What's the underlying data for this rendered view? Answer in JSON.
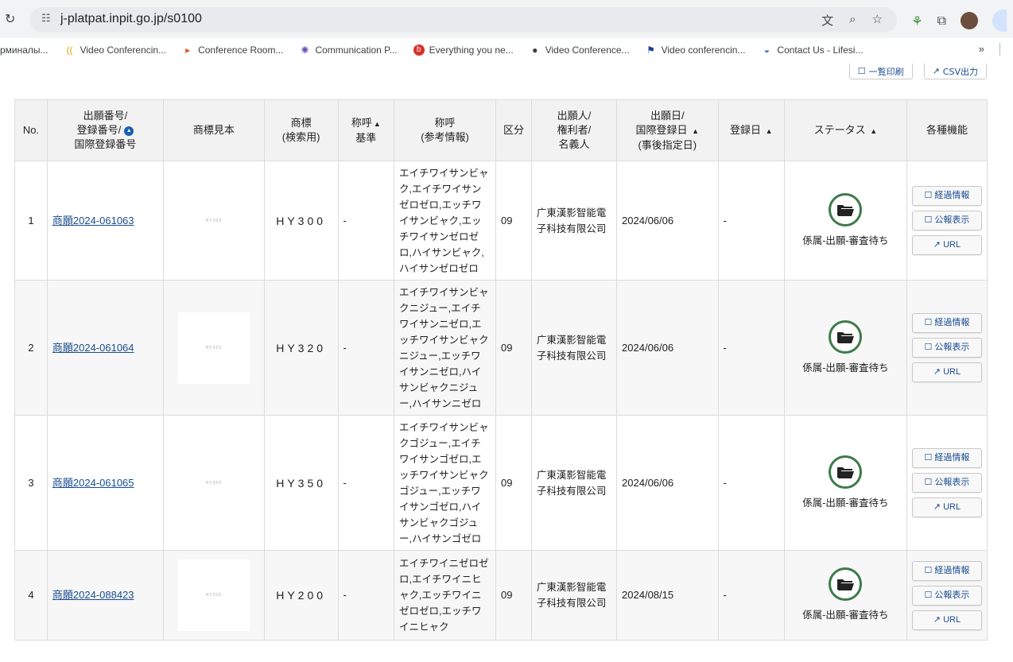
{
  "browser": {
    "url": "j-platpat.inpit.go.jp/s0100"
  },
  "bookmarks": [
    {
      "label": "рминалы...",
      "icon": ""
    },
    {
      "label": "Video Conferencin...",
      "icon": "signal-icon"
    },
    {
      "label": "Conference Room...",
      "icon": "play-icon"
    },
    {
      "label": "Communication P...",
      "icon": "star-icon"
    },
    {
      "label": "Everything you ne...",
      "icon": "b-icon"
    },
    {
      "label": "Video Conference...",
      "icon": "globe-icon"
    },
    {
      "label": "Video conferencin...",
      "icon": "flag-icon"
    },
    {
      "label": "Contact Us - Lifesi...",
      "icon": "lifesize-icon"
    }
  ],
  "bookmarks_more": "»",
  "actions": {
    "print_label": "一覧印刷",
    "csv_label": "CSV出力"
  },
  "table": {
    "headers": {
      "no": "No.",
      "app_no_1": "出願番号/",
      "app_no_2": "登録番号/",
      "app_no_3": "国際登録番号",
      "sample": "商標見本",
      "mark_1": "商標",
      "mark_2": "(検索用)",
      "base_1": "称呼",
      "base_2": "基準",
      "ref_1": "称呼",
      "ref_2": "(参考情報)",
      "class": "区分",
      "owner_1": "出願人/",
      "owner_2": "権利者/",
      "owner_3": "名義人",
      "date_1": "出願日/",
      "date_2": "国際登録日",
      "date_3": "(事後指定日)",
      "reg_date": "登録日",
      "status": "ステータス",
      "functions": "各種機能"
    },
    "rows": [
      {
        "no": "1",
        "app_no": "商願2024-061063",
        "sample_text": "HY300",
        "mark": "HY300",
        "base": "-",
        "reference": "エイチワイサンビャク,エイチワイサンゼロゼロ,エッチワイサンビャク,エッチワイサンゼロゼロ,ハイサンビャク,ハイサンゼロゼロ",
        "class": "09",
        "owner": "广東漢影智能電子科技有限公司",
        "date": "2024/06/06",
        "reg_date": "-",
        "status": "係属-出願-審査待ち"
      },
      {
        "no": "2",
        "app_no": "商願2024-061064",
        "sample_text": "HY320",
        "mark": "HY320",
        "base": "-",
        "reference": "エイチワイサンビャクニジュー,エイチワイサンニゼロ,エッチワイサンビャクニジュー,エッチワイサンニゼロ,ハイサンビャクニジュー,ハイサンニゼロ",
        "class": "09",
        "owner": "广東漢影智能電子科技有限公司",
        "date": "2024/06/06",
        "reg_date": "-",
        "status": "係属-出願-審査待ち"
      },
      {
        "no": "3",
        "app_no": "商願2024-061065",
        "sample_text": "HY350",
        "mark": "HY350",
        "base": "-",
        "reference": "エイチワイサンビャクゴジュー,エイチワイサンゴゼロ,エッチワイサンビャクゴジュー,エッチワイサンゴゼロ,ハイサンビャクゴジュー,ハイサンゴゼロ",
        "class": "09",
        "owner": "广東漢影智能電子科技有限公司",
        "date": "2024/06/06",
        "reg_date": "-",
        "status": "係属-出願-審査待ち"
      },
      {
        "no": "4",
        "app_no": "商願2024-088423",
        "sample_text": "HY200",
        "mark": "HY200",
        "base": "-",
        "reference": "エイチワイニゼロゼロ,エイチワイニヒャク,エッチワイニゼロゼロ,エッチワイニヒャク",
        "class": "09",
        "owner": "广東漢影智能電子科技有限公司",
        "date": "2024/08/15",
        "reg_date": "-",
        "status": "係属-出願-審査待ち"
      }
    ],
    "function_buttons": {
      "progress": "経過情報",
      "gazette": "公報表示",
      "url": "URL"
    }
  },
  "colors": {
    "link": "#1a4d8f",
    "status_ring": "#3e7b4a",
    "header_bg": "#f2f2f2"
  }
}
